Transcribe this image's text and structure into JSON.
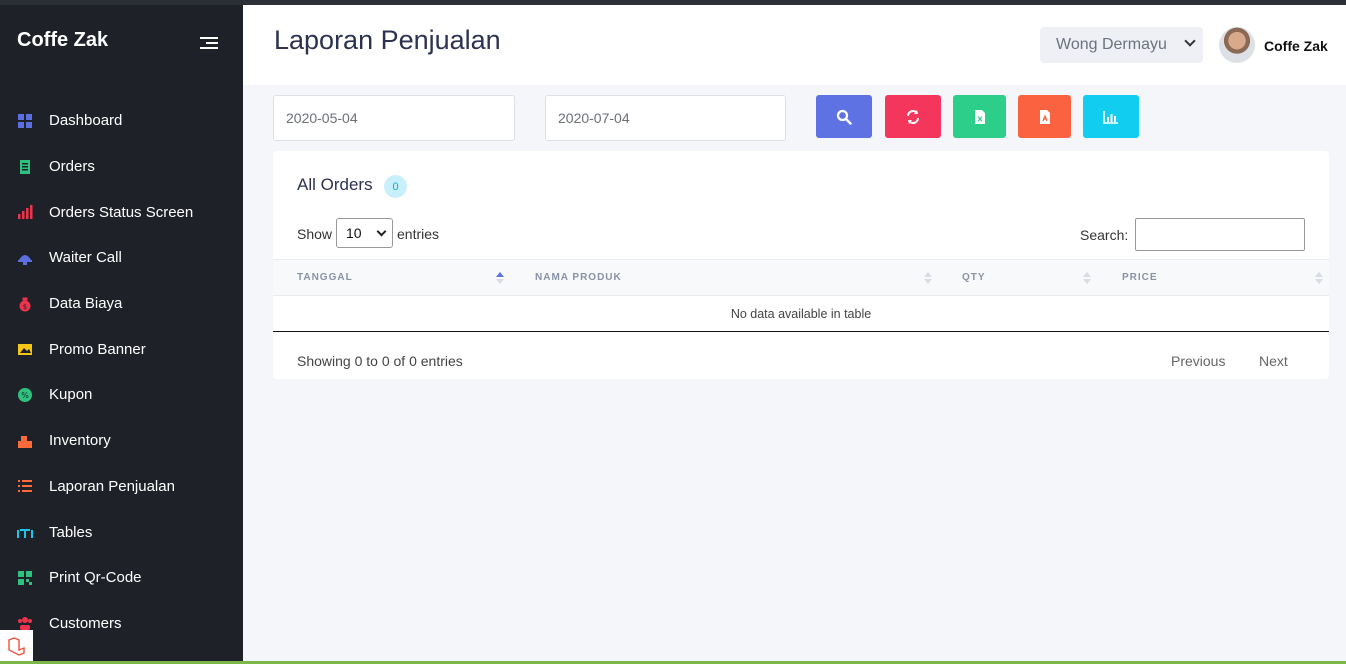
{
  "sidebar": {
    "brand": "Coffe Zak",
    "items": [
      {
        "label": "Dashboard",
        "icon": "grid-icon",
        "color": "#5b6fe0"
      },
      {
        "label": "Orders",
        "icon": "receipt-icon",
        "color": "#2ec27e"
      },
      {
        "label": "Orders Status Screen",
        "icon": "bar-chart-icon",
        "color": "#f0334d"
      },
      {
        "label": "Waiter Call",
        "icon": "bell-icon",
        "color": "#5b6fe0"
      },
      {
        "label": "Data Biaya",
        "icon": "money-bag-icon",
        "color": "#f0334d"
      },
      {
        "label": "Promo Banner",
        "icon": "image-icon",
        "color": "#f5c518"
      },
      {
        "label": "Kupon",
        "icon": "coupon-icon",
        "color": "#2ec27e"
      },
      {
        "label": "Inventory",
        "icon": "inventory-icon",
        "color": "#ff6a3d"
      },
      {
        "label": "Laporan Penjualan",
        "icon": "list-icon",
        "color": "#ff6a3d"
      },
      {
        "label": "Tables",
        "icon": "table-icon",
        "color": "#1cc6e8"
      },
      {
        "label": "Print Qr-Code",
        "icon": "qrcode-icon",
        "color": "#2ec27e"
      },
      {
        "label": "Customers",
        "icon": "users-icon",
        "color": "#f0334d"
      }
    ]
  },
  "header": {
    "title": "Laporan Penjualan",
    "branch": "Wong Dermayu",
    "user": "Coffe Zak"
  },
  "filters": {
    "date_from": "2020-05-04",
    "date_to": "2020-07-04",
    "buttons": [
      {
        "name": "search-button",
        "icon": "search-icon",
        "color": "#5e72e4"
      },
      {
        "name": "refresh-button",
        "icon": "refresh-icon",
        "color": "#f5365c"
      },
      {
        "name": "export-excel-button",
        "icon": "excel-icon",
        "color": "#2dce89"
      },
      {
        "name": "export-pdf-button",
        "icon": "pdf-icon",
        "color": "#fb6340"
      },
      {
        "name": "chart-button",
        "icon": "chart-icon",
        "color": "#11cdef"
      }
    ]
  },
  "table": {
    "title": "All Orders",
    "count": "0",
    "show_label": "Show",
    "page_length": "10",
    "entries_label": "entries",
    "search_label": "Search:",
    "columns": [
      "TANGGAL",
      "NAMA PRODUK",
      "QTY",
      "PRICE"
    ],
    "empty_text": "No data available in table",
    "info": "Showing 0 to 0 of 0 entries",
    "prev": "Previous",
    "next": "Next"
  }
}
